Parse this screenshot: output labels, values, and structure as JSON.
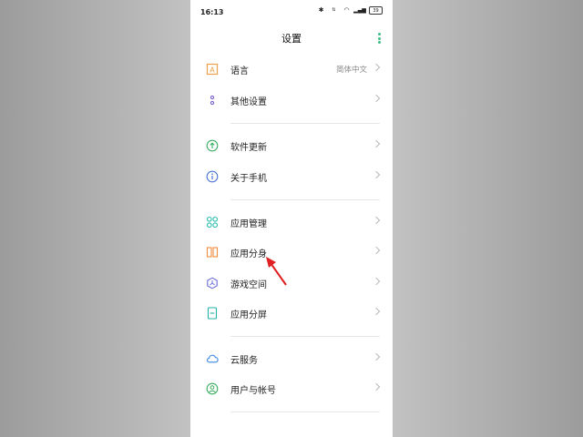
{
  "status_bar": {
    "time": "16:13",
    "icons": [
      "bluetooth-icon",
      "network-speed-icon",
      "wifi-icon",
      "signal-5g-icon",
      "battery-icon"
    ],
    "battery": "39"
  },
  "header": {
    "title": "设置"
  },
  "groups": [
    {
      "items": [
        {
          "label": "语言",
          "value": "简体中文",
          "icon": "language-icon",
          "color": "#f0a04b"
        },
        {
          "label": "其他设置",
          "icon": "more-settings-icon",
          "color": "#7b61d1"
        }
      ]
    },
    {
      "items": [
        {
          "label": "软件更新",
          "icon": "update-icon",
          "color": "#3cae5f"
        },
        {
          "label": "关于手机",
          "icon": "info-icon",
          "color": "#4a73d6"
        }
      ]
    },
    {
      "items": [
        {
          "label": "应用管理",
          "icon": "app-grid-icon",
          "color": "#2dbeb0"
        },
        {
          "label": "应用分身",
          "icon": "app-clone-icon",
          "color": "#f08a3c"
        },
        {
          "label": "游戏空间",
          "icon": "game-space-icon",
          "color": "#6a6fd8"
        },
        {
          "label": "应用分屏",
          "icon": "split-screen-icon",
          "color": "#20b2a8"
        }
      ]
    },
    {
      "items": [
        {
          "label": "云服务",
          "icon": "cloud-icon",
          "color": "#3b86e6"
        },
        {
          "label": "用户与帐号",
          "icon": "account-icon",
          "color": "#3cae5f"
        }
      ]
    }
  ],
  "annotation": {
    "color": "#e02020"
  }
}
